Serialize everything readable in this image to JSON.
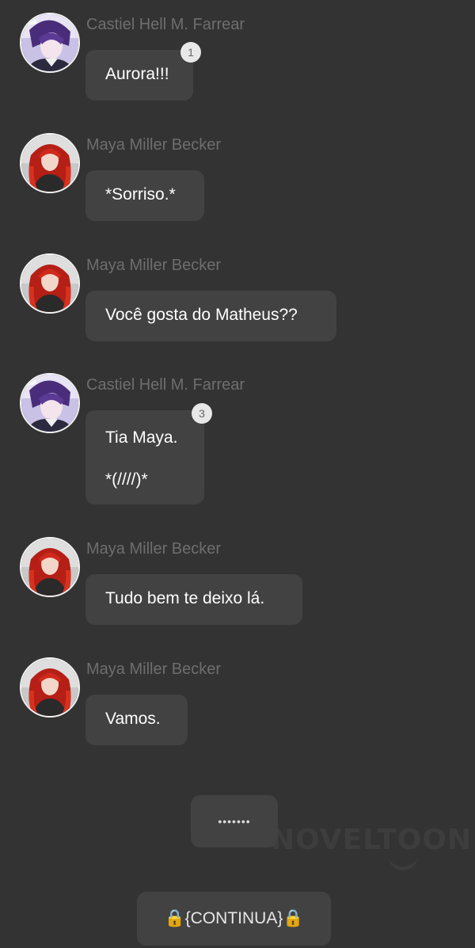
{
  "app": {
    "watermark": "NOVELTOON"
  },
  "messages": [
    {
      "sender": "Castiel Hell M. Farrear",
      "avatar": "castiel-avatar",
      "lines": [
        "Aurora!!!"
      ],
      "badge": "1"
    },
    {
      "sender": "Maya Miller Becker",
      "avatar": "maya-avatar",
      "lines": [
        "*Sorriso.*"
      ]
    },
    {
      "sender": "Maya Miller Becker",
      "avatar": "maya-avatar",
      "lines": [
        "Você gosta do Matheus??"
      ]
    },
    {
      "sender": "Castiel Hell M. Farrear",
      "avatar": "castiel-avatar",
      "lines": [
        "Tia Maya.",
        "",
        "*(////)*"
      ],
      "badge": "3"
    },
    {
      "sender": "Maya Miller Becker",
      "avatar": "maya-avatar",
      "lines": [
        "Tudo bem te deixo lá."
      ]
    },
    {
      "sender": "Maya Miller Becker",
      "avatar": "maya-avatar",
      "lines": [
        "Vamos."
      ]
    }
  ],
  "narration": {
    "dots": "•••••••",
    "continua": "🔒{CONTINUA}🔒"
  },
  "colors": {
    "background": "#333333",
    "bubble": "#424242",
    "sender_text": "#6e6e6e",
    "message_text": "#ffffff",
    "badge": "#e8e8e8"
  }
}
